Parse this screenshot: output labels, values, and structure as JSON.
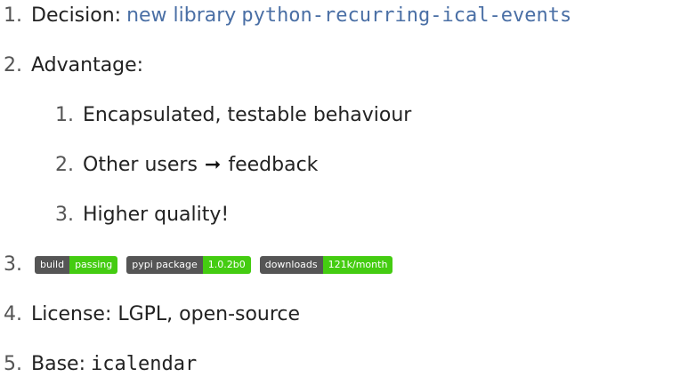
{
  "items": [
    {
      "number": "1.",
      "label": "Decision:",
      "link_text": "new library",
      "code": "python-recurring-ical-events"
    },
    {
      "number": "2.",
      "label": "Advantage:",
      "subitems": [
        {
          "number": "1.",
          "label": "Encapsulated, testable behaviour"
        },
        {
          "number": "2.",
          "label_before": "Other users",
          "label_after": "feedback"
        },
        {
          "number": "3.",
          "label": "Higher quality!"
        }
      ]
    },
    {
      "number": "3.",
      "badges": [
        {
          "left": "build",
          "right": "passing",
          "color": "#4c1"
        },
        {
          "left": "pypi package",
          "right": "1.0.2b0",
          "color": "#4c1"
        },
        {
          "left": "downloads",
          "right": "121k/month",
          "color": "#4c1"
        }
      ]
    },
    {
      "number": "4.",
      "label": "License: LGPL, open-source"
    },
    {
      "number": "5.",
      "label": "Base:",
      "code": "icalendar"
    }
  ],
  "arrow_icon": "right-arrow-icon"
}
